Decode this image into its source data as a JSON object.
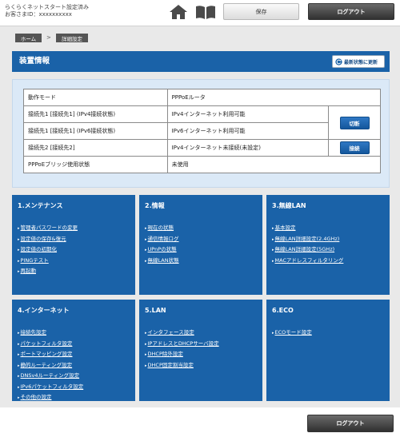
{
  "header": {
    "status_line1": "らくらくネットスタート設定済み",
    "status_line2": "お客さまID：xxxxxxxxxx",
    "home_icon": "home-icon",
    "manual_icon": "book-icon",
    "save_label": "保存",
    "logout_label": "ログアウト"
  },
  "breadcrumb": {
    "home": "ホーム",
    "separator": ">",
    "current": "詳細設定"
  },
  "section": {
    "title": "装置情報",
    "refresh_label": "最新状態に更新"
  },
  "info": {
    "rows": [
      {
        "key": "動作モード",
        "value": "PPPoEルータ"
      },
      {
        "key": "接続先1 [接続先1] (IPv4接続状態)",
        "value": "IPv4インターネット利用可能"
      },
      {
        "key": "接続先1 [接続先1] (IPv6接続状態)",
        "value": "IPv6インターネット利用可能"
      },
      {
        "key": "接続先2 [接続先2]",
        "value": "IPv4インターネット未接続(未設定)"
      },
      {
        "key": "PPPoEブリッジ使用状態",
        "value": "未使用"
      }
    ],
    "disconnect_label": "切断",
    "connect_label": "接続"
  },
  "menus": [
    {
      "title": "1.メンテナンス",
      "items": [
        "管理者パスワードの変更",
        "設定値の保存&復元",
        "設定値の初期化",
        "PINGテスト",
        "再起動"
      ]
    },
    {
      "title": "2.情報",
      "items": [
        "現在の状態",
        "通信情報ログ",
        "UPnPの状態",
        "無線LAN状態"
      ]
    },
    {
      "title": "3.無線LAN",
      "items": [
        "基本設定",
        "無線LAN詳細設定(2.4GHz)",
        "無線LAN詳細設定(5GHz)",
        "MACアドレスフィルタリング"
      ]
    },
    {
      "title": "4.インターネット",
      "items": [
        "接続先設定",
        "パケットフィルタ設定",
        "ポートマッピング設定",
        "静的ルーティング設定",
        "DNSv4ルーティング設定",
        "IPv6パケットフィルタ設定",
        "その他の設定"
      ]
    },
    {
      "title": "5.LAN",
      "items": [
        "インタフェース設定",
        "IPアドレスとDHCPサーバ設定",
        "DHCP除外設定",
        "DHCP固定割当設定"
      ]
    },
    {
      "title": "6.ECO",
      "items": [
        "ECOモード設定"
      ]
    }
  ],
  "footer": {
    "logout_label": "ログアウト"
  }
}
